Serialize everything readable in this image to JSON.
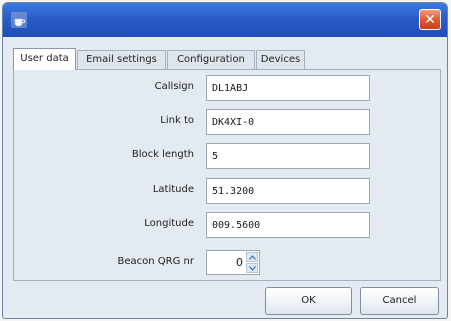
{
  "window": {
    "icon": "java-cup-icon",
    "close_icon": "close-icon",
    "close_glyph": "✕"
  },
  "tabs": [
    {
      "label": "User data",
      "selected": true
    },
    {
      "label": "Email settings",
      "selected": false
    },
    {
      "label": "Configuration",
      "selected": false
    },
    {
      "label": "Devices",
      "selected": false
    }
  ],
  "form": {
    "callsign": {
      "label": "Callsign",
      "value": "DL1ABJ"
    },
    "link_to": {
      "label": "Link to",
      "value": "DK4XI-0"
    },
    "block_length": {
      "label": "Block length",
      "value": "5"
    },
    "latitude": {
      "label": "Latitude",
      "value": "51.3200"
    },
    "longitude": {
      "label": "Longitude",
      "value": "009.5600"
    },
    "beacon_qrg": {
      "label": "Beacon QRG nr",
      "value": "0"
    }
  },
  "buttons": {
    "ok": "OK",
    "cancel": "Cancel"
  }
}
